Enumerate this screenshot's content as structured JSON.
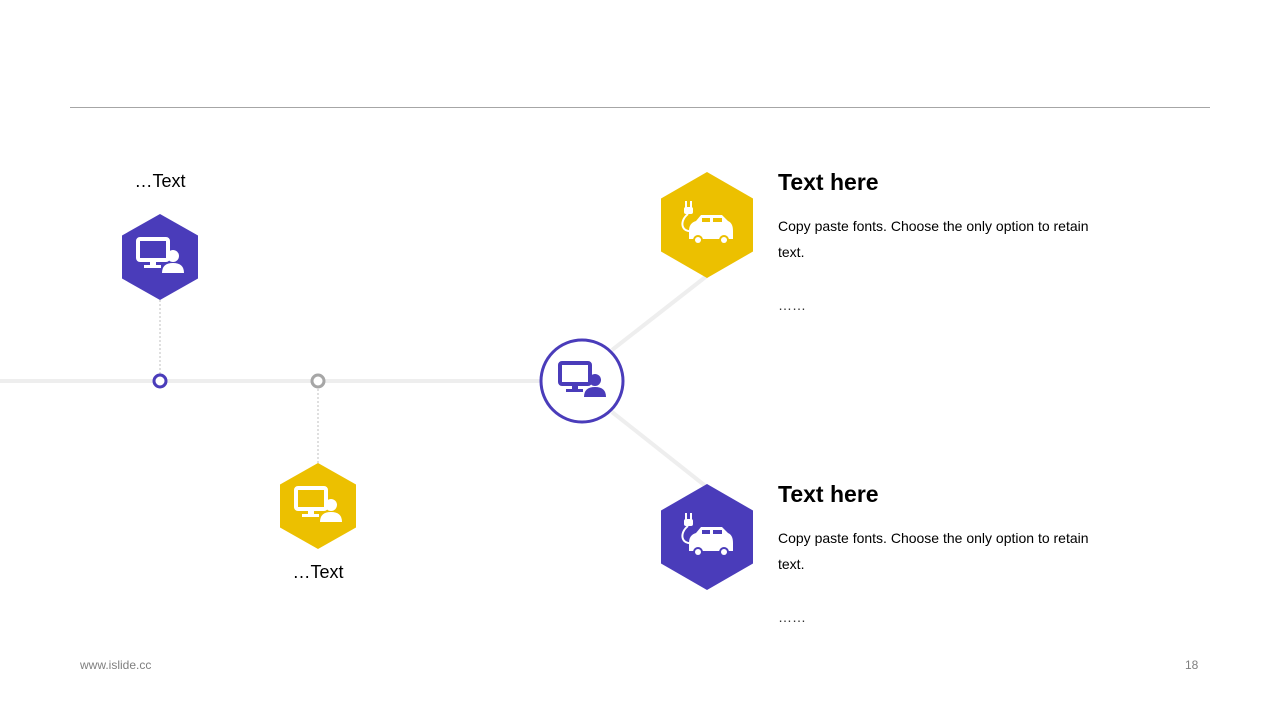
{
  "colors": {
    "purple": "#4a3cba",
    "yellow": "#ecc000",
    "line": "#eeeeee",
    "connector": "#bfbfbf",
    "grey_dot": "#a6a6a6"
  },
  "timeline": {
    "node_top": {
      "label": "…Text",
      "icon": "monitor-user-icon",
      "color": "purple"
    },
    "node_bottom": {
      "label": "…Text",
      "icon": "monitor-user-icon",
      "color": "yellow"
    },
    "center_icon": "monitor-user-icon"
  },
  "cards": [
    {
      "title": "Text here",
      "body": "Copy paste fonts. Choose the only option to retain text.",
      "more": "……",
      "icon": "electric-car-icon",
      "color": "yellow"
    },
    {
      "title": "Text here",
      "body": "Copy paste fonts. Choose the only option to retain text.",
      "more": "……",
      "icon": "electric-car-icon",
      "color": "purple"
    }
  ],
  "footer": {
    "website": "www.islide.cc",
    "page_number": "18"
  }
}
